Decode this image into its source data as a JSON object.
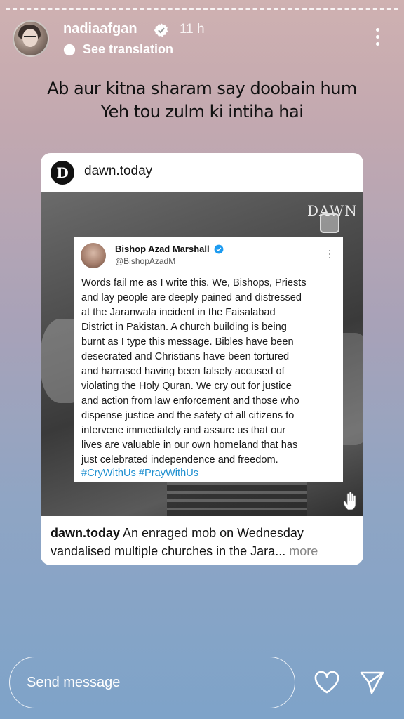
{
  "story": {
    "username": "nadiaafgan",
    "time": "11 h",
    "translate_label": "See translation",
    "caption_lines": [
      "Ab aur kitna sharam say doobain hum",
      "Yeh tou zulm ki intiha hai"
    ]
  },
  "shared_post": {
    "logo_letter": "D",
    "source": "dawn.today",
    "watermark": "DAWN",
    "tweet": {
      "name": "Bishop Azad Marshall",
      "handle": "@BishopAzadM",
      "body_lines": [
        "Words fail me as I write this. We, Bishops, Priests",
        "and lay people are deeply pained and distressed",
        "at the Jaranwala incident in the Faisalabad",
        "District in Pakistan. A church building is being",
        "burnt as I type this message. Bibles have been",
        "desecrated and Christians have been tortured",
        "and harrased having been falsely accused of",
        "violating the Holy Quran. We cry out for justice",
        "and action from law enforcement and those who",
        "dispense justice and the safety of all citizens to",
        "intervene immediately and assure us that our",
        "lives are valuable in our own homeland that has",
        "just celebrated independence and freedom."
      ],
      "hashtags": "#CryWithUs #PrayWithUs"
    },
    "caption_author": "dawn.today",
    "caption_text_1": " An enraged mob on Wednesday",
    "caption_text_2": "vandalised multiple churches in the Jara",
    "caption_ellipsis": "...",
    "caption_more": " more"
  },
  "footer": {
    "message_placeholder": "Send message"
  },
  "icons": {
    "verified": "verified-badge-icon",
    "like": "heart-icon",
    "send": "send-icon"
  },
  "colors": {
    "hashtag": "#1d8fd0",
    "verified": "#1d9bf0"
  }
}
